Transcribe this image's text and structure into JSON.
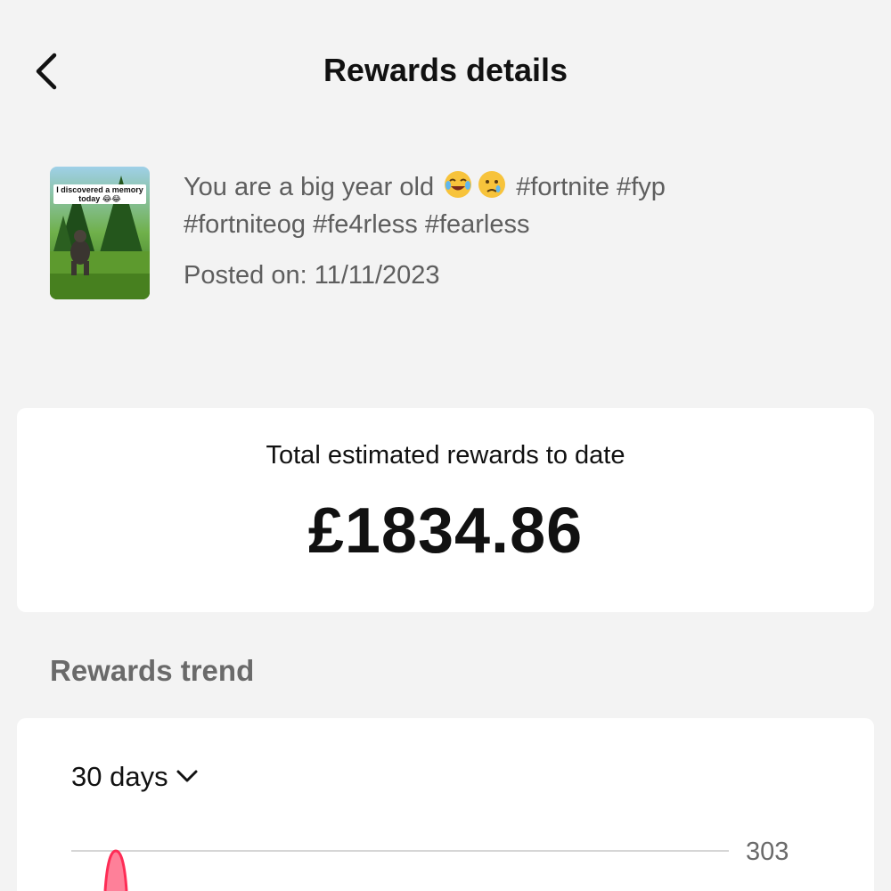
{
  "header": {
    "title": "Rewards details",
    "back_icon": "chevron-left-icon"
  },
  "video": {
    "thumbnail_caption": "I discovered a memory today 😂😂",
    "caption_line1": "You are a big year old",
    "caption_emojis": [
      "tears-of-joy-emoji",
      "crying-face-emoji"
    ],
    "caption_line1_tags": "#fortnite #fyp",
    "caption_line2": "#fortniteog #fe4rless #fearless",
    "posted_on": "Posted on: 11/11/2023"
  },
  "total": {
    "label": "Total estimated rewards to date",
    "value": "£1834.86"
  },
  "trend": {
    "heading": "Rewards trend",
    "range": "30 days",
    "range_icon": "chevron-down-icon"
  },
  "chart_data": {
    "type": "area",
    "y_tick_labels": [
      "303"
    ],
    "series_color": "#fe2c55",
    "grid": true
  },
  "colors": {
    "background": "#f3f3f3",
    "card": "#ffffff",
    "accent": "#fe2c55"
  }
}
